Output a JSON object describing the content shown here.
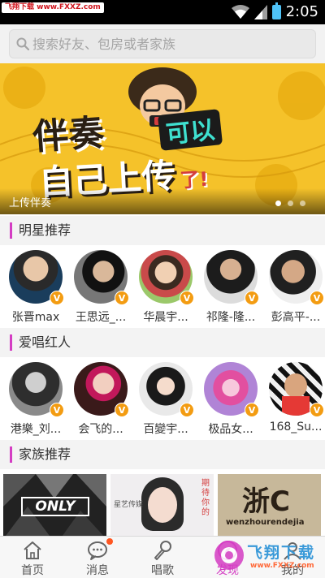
{
  "status_bar": {
    "watermark": "飞翔下载 www.FXXZ.com",
    "time": "2:05"
  },
  "search": {
    "placeholder": "搜索好友、包房或者家族"
  },
  "banner": {
    "headline_line1": "伴奏",
    "headline_accent": "可以",
    "headline_line2": "自己上传",
    "headline_suffix": "了!",
    "caption": "上传伴奏",
    "page_count": 3,
    "active_index": 0
  },
  "star_section": {
    "title": "明星推荐",
    "people": [
      {
        "name": "张晋max",
        "badge": "V"
      },
      {
        "name": "王思远_...",
        "badge": "V"
      },
      {
        "name": "华晨宇...",
        "badge": "V"
      },
      {
        "name": "祁隆-隆...",
        "badge": "V"
      },
      {
        "name": "彭高平-...",
        "badge": "V"
      }
    ]
  },
  "red_section": {
    "title": "爱唱红人",
    "people": [
      {
        "name": "港樂_刘...",
        "badge": "V"
      },
      {
        "name": "会飞的...",
        "badge": "V"
      },
      {
        "name": "百變宇...",
        "badge": "V"
      },
      {
        "name": "极品女...",
        "badge": "V"
      },
      {
        "name": "168_Su...",
        "badge": "V"
      }
    ]
  },
  "family_section": {
    "title": "家族推荐",
    "tiles": [
      {
        "text": "ONLY"
      },
      {
        "text": "星艺传媒",
        "side_text": "期待你的"
      },
      {
        "text": "浙C",
        "sub_text": "wenzhourendejia"
      }
    ]
  },
  "bottom_nav": {
    "items": [
      {
        "label": "首页",
        "icon": "home-icon"
      },
      {
        "label": "消息",
        "icon": "chat-icon"
      },
      {
        "label": "唱歌",
        "icon": "microphone-icon"
      },
      {
        "label": "发现",
        "icon": "compass-icon"
      },
      {
        "label": "我的",
        "icon": "person-icon"
      }
    ],
    "active_index": 3
  },
  "watermark_logo": {
    "title": "飞翔下载",
    "url": "www.FXXZ.com"
  },
  "colors": {
    "accent": "#d43dc3",
    "badge": "#f39c12",
    "banner_bg": "#f5c22a"
  }
}
